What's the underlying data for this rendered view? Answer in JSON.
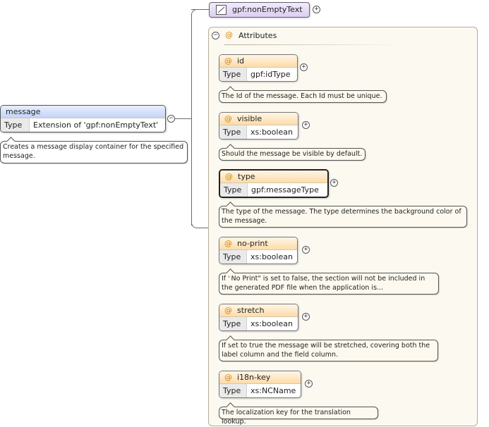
{
  "root": {
    "name": "message",
    "type_key": "Type",
    "type_value": "Extension of 'gpf:nonEmptyText'",
    "doc": "Creates a message display container for the specified message.",
    "collapse_symbol": "−"
  },
  "simple_content": {
    "name": "gpf:nonEmptyText",
    "expand_symbol": "+"
  },
  "attributes": {
    "label": "Attributes",
    "at_symbol": "@",
    "collapse_symbol": "−",
    "expand_symbol": "+",
    "items": [
      {
        "name": "id",
        "type_key": "Type",
        "type": "gpf:idType",
        "doc": "The Id of the message. Each Id must be unique."
      },
      {
        "name": "visible",
        "type_key": "Type",
        "type": "xs:boolean",
        "doc": "Should the message be visible by default."
      },
      {
        "name": "type",
        "type_key": "Type",
        "type": "gpf:messageType",
        "doc": "The type of the message. The type determines the background color of the message."
      },
      {
        "name": "no-print",
        "type_key": "Type",
        "type": "xs:boolean",
        "doc": "If \"No Print\" is set to false, the section will not be included in the generated PDF file when the application is..."
      },
      {
        "name": "stretch",
        "type_key": "Type",
        "type": "xs:boolean",
        "doc": "If set to true the message will be stretched, covering both the label column and the field column."
      },
      {
        "name": "i18n-key",
        "type_key": "Type",
        "type": "xs:NCName",
        "doc": "The localization key for the translation lookup."
      }
    ]
  },
  "colors": {
    "root_header": "#c3d4f7",
    "attr_header": "#fcdcaa",
    "attr_at": "#d08400",
    "simple_content": "#dccff1",
    "container_bg": "#fcf9f1"
  }
}
